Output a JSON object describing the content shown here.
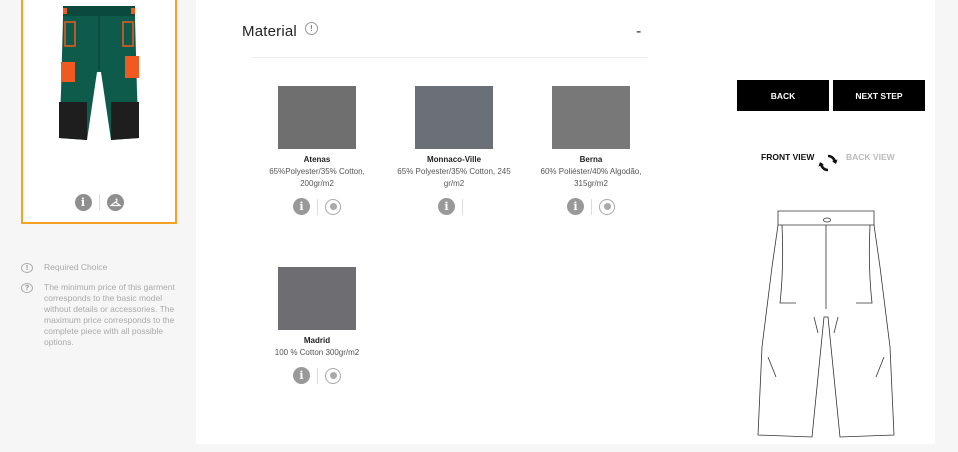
{
  "sidebar": {
    "notes": [
      {
        "icon": "!",
        "text": "Required Choice"
      },
      {
        "icon": "?",
        "text": "The minimum price of this garment corresponds to the basic model without details or accessories. The maximum price corresponds to the complete piece with all possible options."
      }
    ]
  },
  "section": {
    "title": "Material",
    "collapse": "-"
  },
  "materials": [
    {
      "name": "Atenas",
      "desc": "65%Polyester/35% Cotton, 200gr/m2",
      "color": "#6f6f6f"
    },
    {
      "name": "Monnaco-Ville",
      "desc": "65% Polyester/35% Cotton, 245 gr/m2",
      "color": "#6b6f78"
    },
    {
      "name": "Berna",
      "desc": "60% Poliéster/40% Algodão, 315gr/m2",
      "color": "#787878"
    },
    {
      "name": "Madrid",
      "desc": "100 % Cotton 300gr/m2",
      "color": "#6e6e72"
    }
  ],
  "actions": {
    "back": "BACK",
    "next": "NEXT STEP"
  },
  "views": {
    "front": "FRONT VIEW",
    "back": "BACK VIEW"
  },
  "colors": {
    "accent": "#f3a226",
    "garment_green": "#0f5b4b",
    "garment_orange": "#ee5a1f"
  }
}
